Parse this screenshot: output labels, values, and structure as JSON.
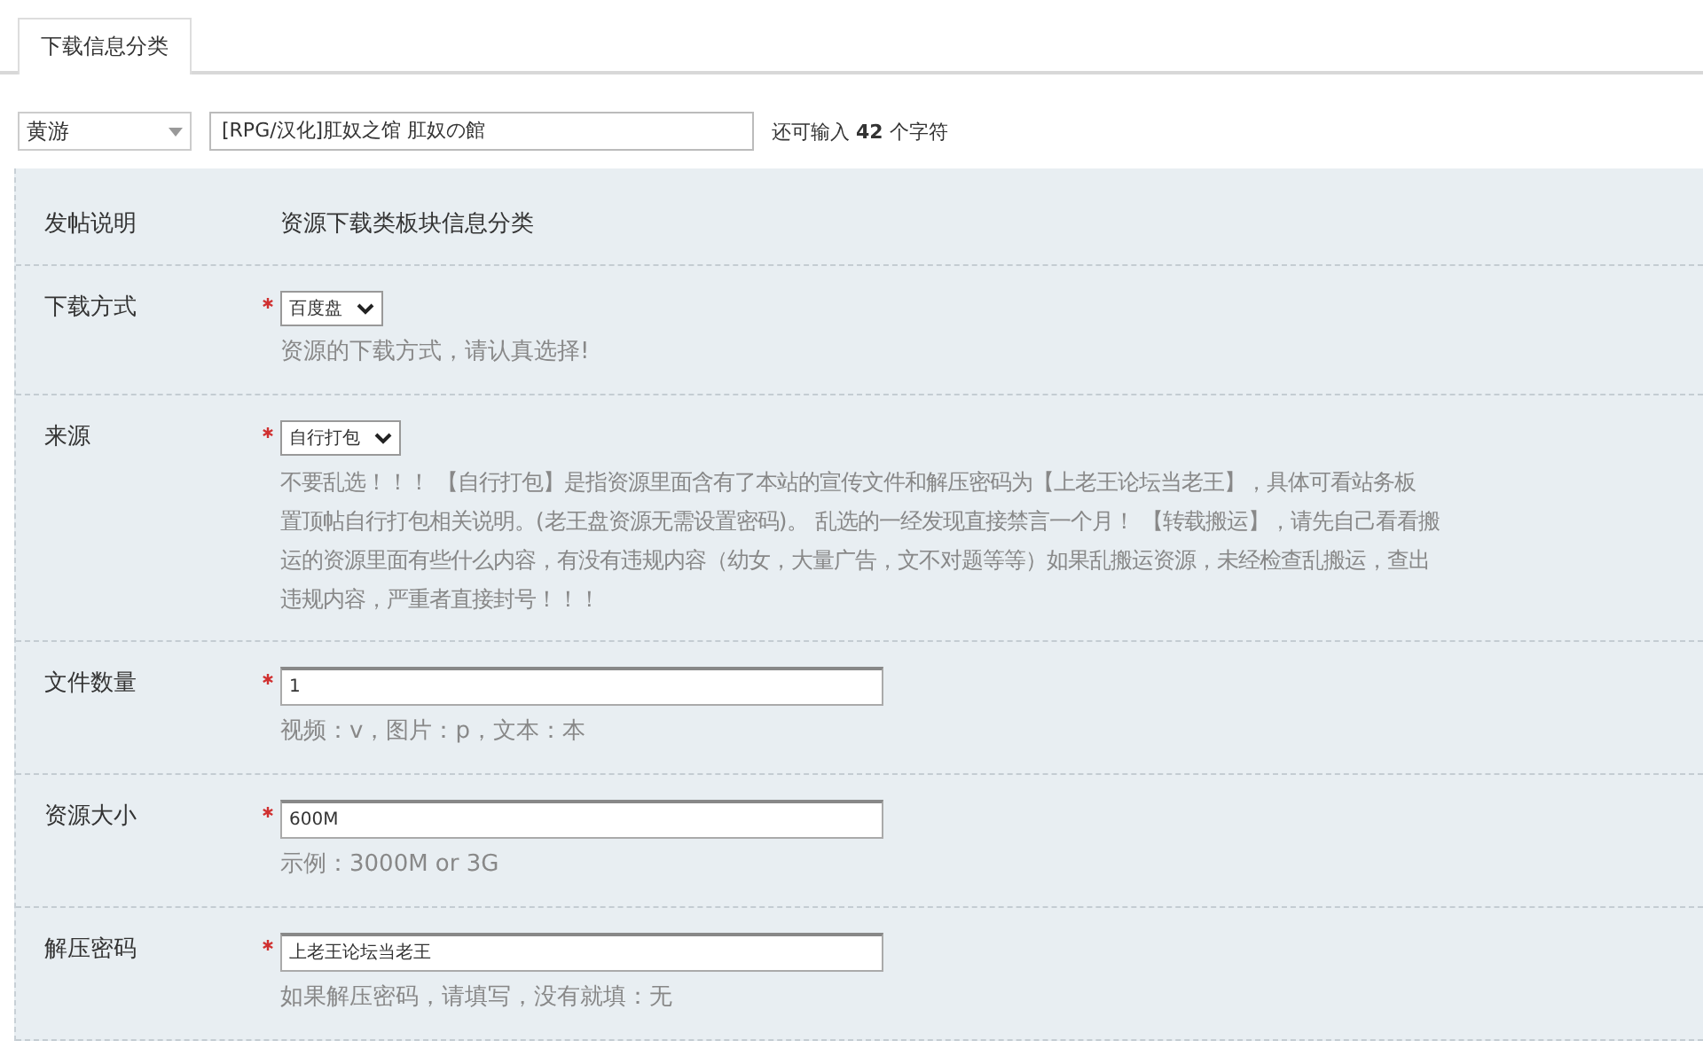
{
  "tabs": [
    {
      "label": "下载信息分类",
      "selected": true
    }
  ],
  "title_bar": {
    "category": "黄游",
    "title": "[RPG/汉化]肛奴之馆 肛奴の館",
    "counter": "还可输入 **42** 个字符"
  },
  "rows": [
    {
      "kind": "text",
      "label": "发帖说明",
      "value": "资源下载类板块信息分类"
    },
    {
      "kind": "select",
      "label": "下载方式",
      "required": true,
      "value": "百度盘",
      "hint_lines": [
        "资源的下载方式，请认真选择!"
      ]
    },
    {
      "kind": "select",
      "label": "来源",
      "required": true,
      "value": "自行打包",
      "hint_lines": [
        "不要乱选！！！ 【自行打包】是指资源里面含有了本站的宣传文件和解压密码为【上老王论坛当老王】，具体可看站务板",
        "置顶帖自行打包相关说明。(老王盘资源无需设置密码)。 乱选的一经发现直接禁言一个月！ 【转载搬运】，请先自己看看搬",
        "运的资源里面有些什么内容，有没有违规内容（幼女，大量广告，文不对题等等）如果乱搬运资源，未经检查乱搬运，查出",
        "违规内容，严重者直接封号！！！"
      ]
    },
    {
      "kind": "input",
      "label": "文件数量",
      "required": true,
      "value": "1",
      "hint_lines": [
        "视频：v，图片：p，文本：本"
      ]
    },
    {
      "kind": "input",
      "label": "资源大小",
      "required": true,
      "value": "600M",
      "hint_lines": [
        "示例：3000M or 3G"
      ]
    },
    {
      "kind": "input",
      "label": "解压密码",
      "required": true,
      "value": "上老王论坛当老王",
      "hint_lines": [
        "如果解压密码，请填写，没有就填：无"
      ]
    }
  ]
}
